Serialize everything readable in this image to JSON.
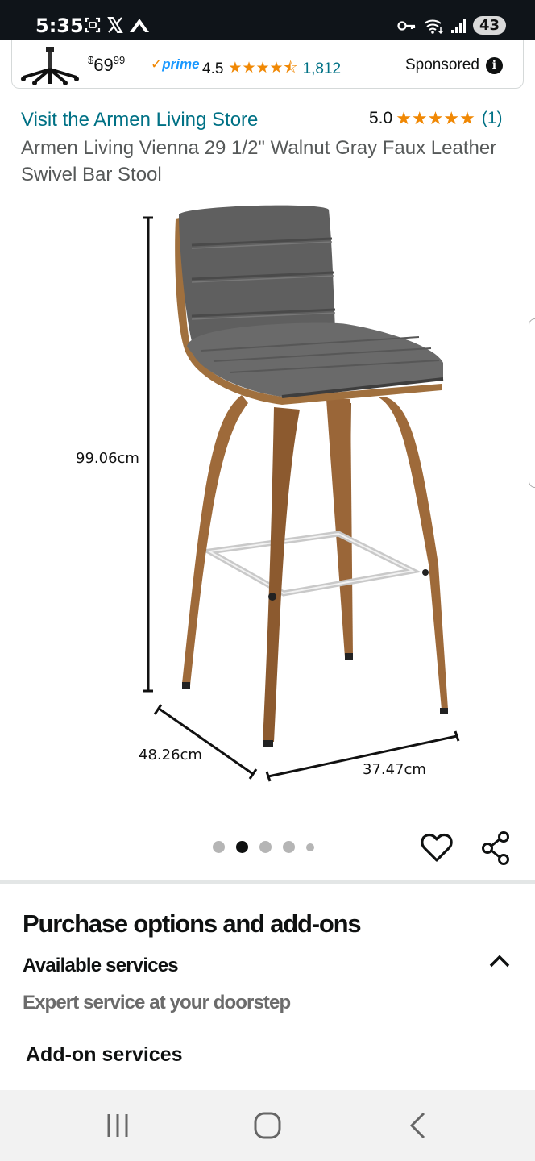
{
  "status_bar": {
    "time": "5:35",
    "battery": "43",
    "left_icons": [
      "screenshot-icon",
      "x-app-icon",
      "mountain-app-icon"
    ],
    "right_icons": [
      "key-icon",
      "wifi-icon",
      "signal-icon"
    ]
  },
  "sponsored_ad": {
    "price_symbol": "$",
    "price_whole": "69",
    "price_fraction": "99",
    "prime_label": "prime",
    "rating": "4.5",
    "rating_count": "1,812",
    "sponsored_label": "Sponsored",
    "star_color": "#f08804"
  },
  "product": {
    "store_link": "Visit the Armen Living Store",
    "rating": "5.0",
    "rating_count": "(1)",
    "title": "Armen Living Vienna 29 1/2\" Walnut Gray Faux Leather Swivel Bar Stool"
  },
  "image": {
    "height_label": "99.06cm",
    "depth_label": "48.26cm",
    "width_label": "37.47cm",
    "carousel_count": 5,
    "carousel_active": 2
  },
  "actions": {
    "wishlist_icon": "heart-icon",
    "share_icon": "share-icon"
  },
  "purchase_options": {
    "title": "Purchase options and add-ons",
    "services_label": "Available services",
    "services_subtitle": "Expert service at your doorstep",
    "addon_label": "Add-on services"
  },
  "nav_bar": {
    "buttons": [
      "recents-icon",
      "home-icon",
      "back-icon"
    ]
  },
  "colors": {
    "link": "#007185",
    "star": "#f08804",
    "prime": "#1a98ff",
    "status_bar_bg": "#0f1419"
  }
}
